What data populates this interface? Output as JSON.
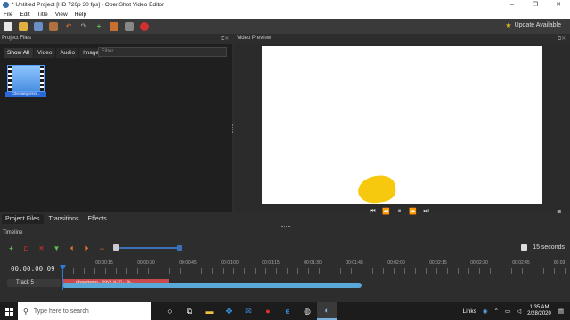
{
  "window": {
    "title": "* Untitled Project [HD 720p 30 fps] - OpenShot Video Editor",
    "controls": [
      "–",
      "❐",
      "✕"
    ]
  },
  "menu": [
    "File",
    "Edit",
    "Title",
    "View",
    "Help"
  ],
  "toolbar": {
    "update_label": "Update Available"
  },
  "project_files": {
    "title": "Project Files",
    "tabs": [
      "Show All",
      "Video",
      "Audio",
      "Image"
    ],
    "active_tab": "Show All",
    "filter_placeholder": "Filter",
    "file_name": "c3vwaeipornn..."
  },
  "video_preview": {
    "title": "Video Preview"
  },
  "bottom_tabs": [
    "Project Files",
    "Transitions",
    "Effects"
  ],
  "timeline": {
    "title": "Timeline",
    "zoom_label": "15 seconds",
    "timecode": "00:00:00:09",
    "ruler": [
      "00:00:15",
      "00:00:30",
      "00:00:45",
      "00:01:00",
      "00:01:15",
      "00:01:30",
      "00:01:45",
      "00:02:00",
      "00:02:15",
      "00:02:30",
      "00:02:45",
      "00:03"
    ],
    "track_name": "Track 5",
    "clip_name": "c3vwaeipornn... 2KtVX (4.27) ... 3r..."
  },
  "taskbar": {
    "search_placeholder": "Type here to search",
    "links_label": "Links",
    "time": "1:35 AM",
    "date": "2/28/2020"
  },
  "colors": {
    "accent": "#2a7ad8",
    "clip": "#c94a4a",
    "blob": "#f6c90e"
  }
}
